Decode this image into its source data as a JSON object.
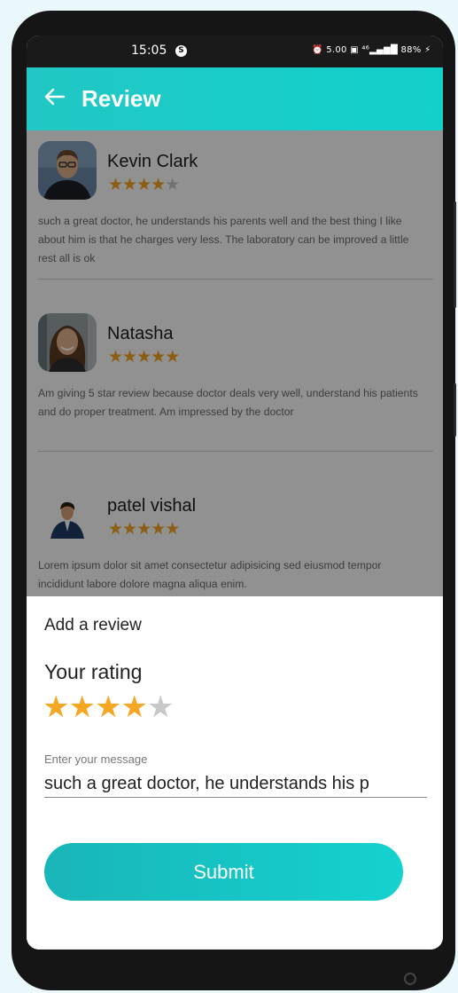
{
  "status_bar": {
    "time": "15:05",
    "notification_badge": "S",
    "icons_text": "⏰ 5.00 ▣ ⁴⁶▂▄▆█ 88% ⚡"
  },
  "app_bar": {
    "title": "Review",
    "back_icon": "arrow-left-icon"
  },
  "reviews": [
    {
      "name": "Kevin Clark",
      "rating": 4,
      "max_rating": 5,
      "text": "such a great doctor, he understands his parents well and the best thing I like about him is that he charges very less. The laboratory can be improved a little rest all is ok"
    },
    {
      "name": "Natasha",
      "rating": 5,
      "max_rating": 5,
      "text": "Am giving 5 star review because doctor deals very well, understand his patients and do proper treatment. Am impressed by the doctor"
    },
    {
      "name": "patel vishal",
      "rating": 5,
      "max_rating": 5,
      "text": "Lorem ipsum dolor sit amet consectetur adipisicing sed eiusmod tempor incididunt labore dolore magna aliqua enim."
    }
  ],
  "add_review": {
    "title": "Add a review",
    "rating_label": "Your rating",
    "rating": 4,
    "max_rating": 5,
    "message_label": "Enter your message",
    "message_value": "such a great doctor, he understands his p",
    "submit_label": "Submit"
  },
  "colors": {
    "accent": "#14cfca",
    "star_filled": "#f5a623",
    "star_empty": "#c8c8c8"
  }
}
